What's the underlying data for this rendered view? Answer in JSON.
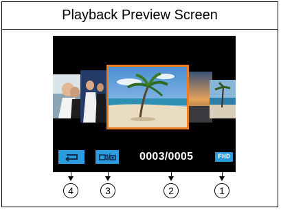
{
  "title": "Playback Preview Screen",
  "status_bar": {
    "back_icon": "return-arrow-icon",
    "mode_icon": "video-photo-mode-icon",
    "counter": "0003/0005",
    "resolution_label": "FHD"
  },
  "callouts": [
    "4",
    "3",
    "2",
    "1"
  ],
  "colors": {
    "status_blue": "#2b9be0",
    "selection_orange": "#f07c1c",
    "screen_background": "#000000"
  }
}
